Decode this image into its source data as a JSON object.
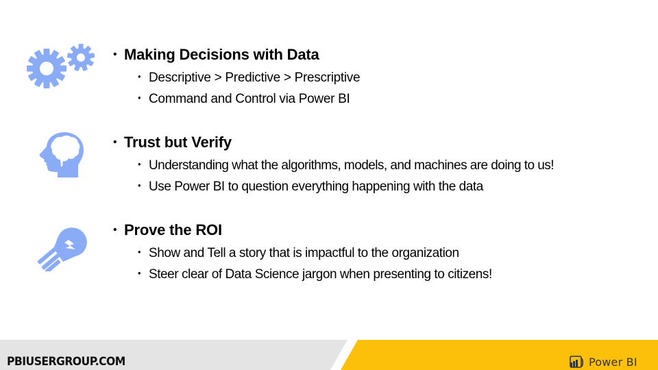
{
  "slide": {
    "sections": [
      {
        "icon": "gears-icon",
        "heading": "Making Decisions with Data",
        "bullets": [
          "Descriptive > Predictive > Prescriptive",
          "Command and Control via Power BI"
        ]
      },
      {
        "icon": "brain-head-icon",
        "heading": "Trust but Verify",
        "bullets": [
          "Understanding what the algorithms, models, and machines are doing to us!",
          "Use Power BI to question everything happening with the data"
        ]
      },
      {
        "icon": "lightbulb-icon",
        "heading": "Prove the ROI",
        "bullets": [
          "Show and Tell a story that is impactful to the organization",
          "Steer clear of Data Science jargon when presenting to citizens!"
        ]
      }
    ],
    "bullet_char": "•"
  },
  "footer": {
    "site": "PBIUSERGROUP.COM",
    "brand": "Power BI"
  },
  "colors": {
    "icon": "#8aabf5",
    "footer_gray": "#e4e4e4",
    "footer_yellow": "#fcbf0a"
  }
}
